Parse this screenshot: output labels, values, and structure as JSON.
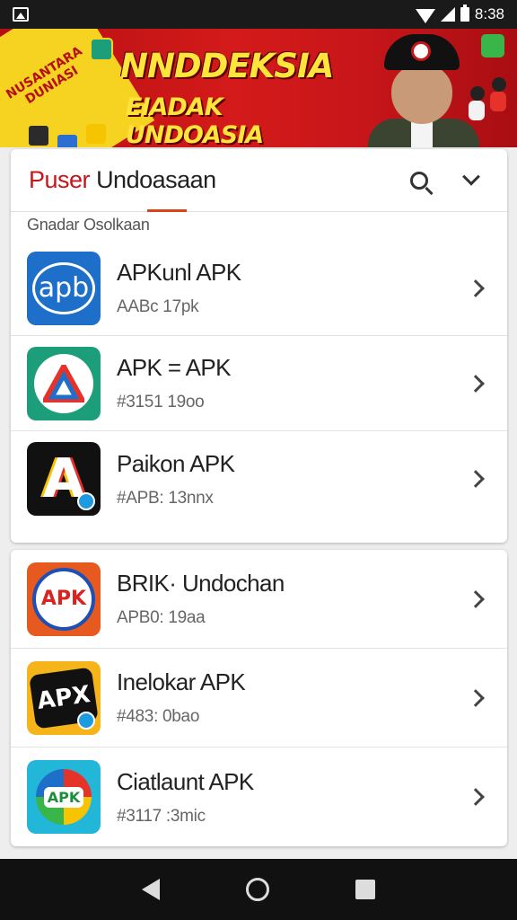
{
  "status_bar": {
    "time": "8:38"
  },
  "banner": {
    "badge_text": "NUSANTARA DUNIASI",
    "title": "NNDDEKSIA",
    "subtitle": "EIADAK UNDOASIA"
  },
  "header": {
    "title_accent": "Puser",
    "title_rest": "Undoasaan"
  },
  "section_label": "Gnadar Osolkaan",
  "apps_group1": [
    {
      "name": "APKunl APK",
      "meta": "AABc 17pk",
      "icon": "apb-icon"
    },
    {
      "name": "APK = APK",
      "meta": "#3151 19oo",
      "icon": "a-triangle-icon"
    },
    {
      "name": "Paikon APK",
      "meta": "#APB: 13nnx",
      "icon": "a-letter-icon"
    }
  ],
  "apps_group2": [
    {
      "name": "BRIK· Undochan",
      "meta": "APB0: 19aa",
      "icon": "apk-badge-icon"
    },
    {
      "name": "Inelokar APK",
      "meta": "#483: 0bao",
      "icon": "apx-icon"
    },
    {
      "name": "Ciatlaunt APK",
      "meta": "#3117 :3mic",
      "icon": "apk-color-icon"
    }
  ],
  "icon_labels": {
    "apb": "apb",
    "apk1": "APK",
    "apx": "APX",
    "apk2": "APK",
    "a": "A"
  },
  "colors": {
    "accent": "#c7161a",
    "banner_yellow": "#ffe53b",
    "underline": "#d8451a"
  }
}
